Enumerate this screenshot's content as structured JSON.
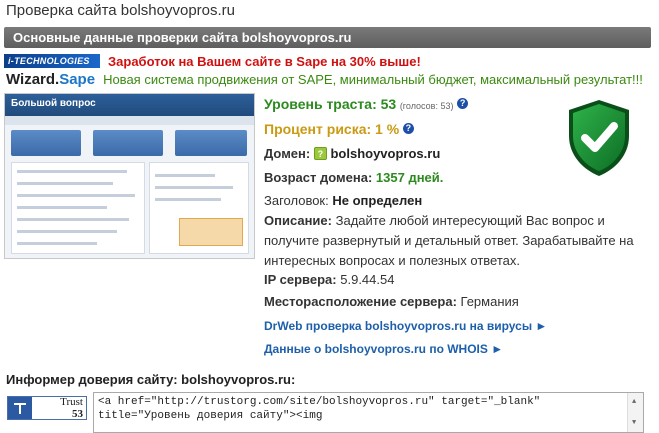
{
  "page": {
    "title": "Проверка сайта bolshoyvopros.ru"
  },
  "header": {
    "label": "Основные данные проверки сайта bolshoyvopros.ru"
  },
  "ads": {
    "itech_logo": "i-TECHNOLOGIES",
    "itech_text": "Заработок на Вашем сайте в Sape на 30% выше!",
    "wizard_logo_a": "Wizard.",
    "wizard_logo_b": "Sape",
    "wizard_text": "Новая система продвижения от SAPE, минимальный бюджет, максимальный результат!!!"
  },
  "screenshot": {
    "logo": "Большой вопрос"
  },
  "info": {
    "trust_label": "Уровень траста: 53",
    "trust_votes": "(голосов: 53)",
    "risk_label": "Процент риска: 1 %",
    "help_glyph": "?",
    "domain_label": "Домен:",
    "domain_icon_glyph": "?",
    "domain_value": "bolshoyvopros.ru",
    "age_label": "Возраст домена:",
    "age_value": "1357 дней.",
    "heading_label": "Заголовок:",
    "heading_value": "Не определен",
    "desc_label": "Описание:",
    "desc_value": "Задайте любой интересующий Вас вопрос и получите развернутый и детальный ответ. Зарабатывайте на интересных вопросах и полезных ответах.",
    "ip_label": "IP сервера:",
    "ip_value": "5.9.44.54",
    "location_label": "Месторасположение сервера:",
    "location_value": "Германия",
    "drweb_link": "DrWeb проверка bolshoyvopros.ru на вирусы ►",
    "whois_link": "Данные о bolshoyvopros.ru по WHOIS ►"
  },
  "informer": {
    "title": "Информер доверия сайту: bolshoyvopros.ru:",
    "badge_word": "Trust",
    "badge_value": "53",
    "code": "<a href=\"http://trustorg.com/site/bolshoyvopros.ru\" target=\"_blank\"\ntitle=\"Уровень доверия сайту\"><img"
  },
  "colors": {
    "header_bar": "#666666",
    "trust_green": "#2c8a1e",
    "risk_gold": "#c99a12",
    "ad_red": "#d01010",
    "ad_green": "#3b8a10",
    "link_blue": "#1d5faa"
  },
  "icons": {
    "help": "help-circle-icon",
    "shield": "green-shield-check-icon",
    "domain": "domain-favicon-icon",
    "scroll_up": "scroll-up-arrow-icon",
    "scroll_down": "scroll-down-arrow-icon"
  }
}
